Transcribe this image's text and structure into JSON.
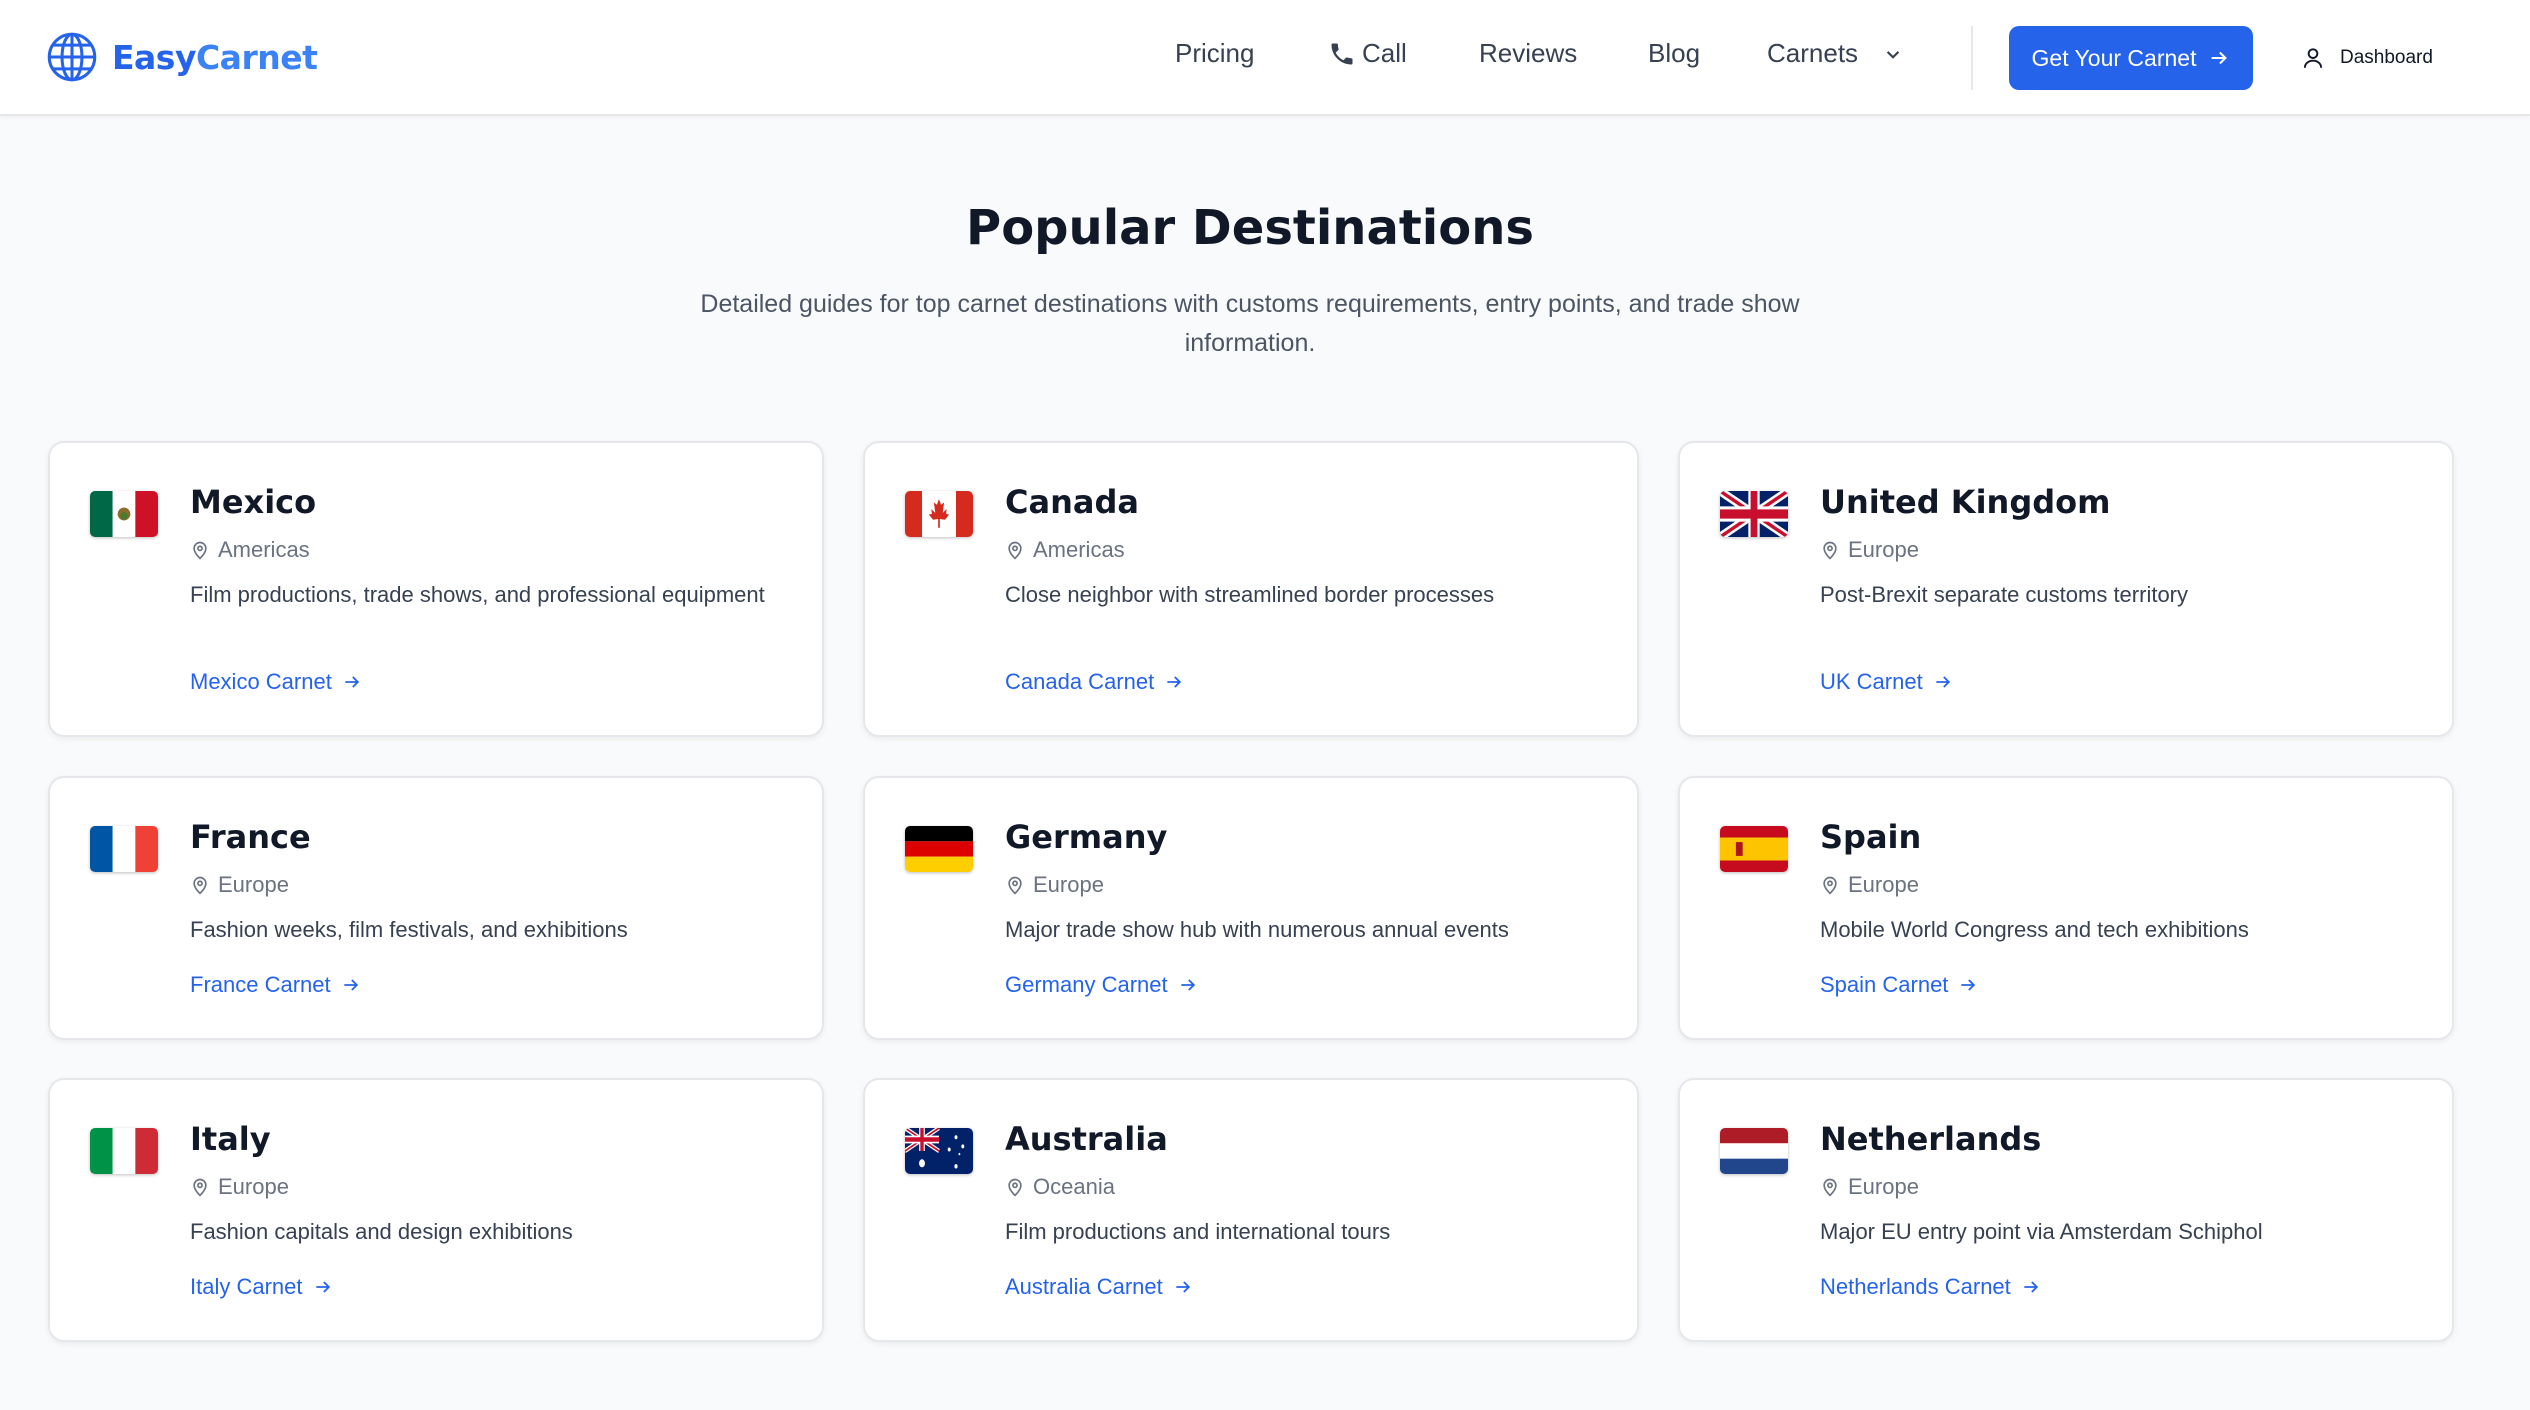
{
  "header": {
    "logo_easy": "Easy",
    "logo_carnet": "Carnet",
    "nav": {
      "pricing": "Pricing",
      "call": "Call",
      "reviews": "Reviews",
      "blog": "Blog",
      "carnets": "Carnets"
    },
    "cta_label": "Get Your Carnet",
    "dashboard_label": "Dashboard",
    "accent_color": "#2563eb"
  },
  "hero": {
    "title": "Popular Destinations",
    "subtitle": "Detailed guides for top carnet destinations with customs requirements, entry points, and trade show information."
  },
  "destinations": [
    {
      "name": "Mexico",
      "region": "Americas",
      "description": "Film productions, trade shows, and professional equipment",
      "link": "Mexico Carnet",
      "flag": "mexico-flag"
    },
    {
      "name": "Canada",
      "region": "Americas",
      "description": "Close neighbor with streamlined border processes",
      "link": "Canada Carnet",
      "flag": "canada-flag"
    },
    {
      "name": "United Kingdom",
      "region": "Europe",
      "description": "Post-Brexit separate customs territory",
      "link": "UK Carnet",
      "flag": "uk-flag"
    },
    {
      "name": "France",
      "region": "Europe",
      "description": "Fashion weeks, film festivals, and exhibitions",
      "link": "France Carnet",
      "flag": "france-flag"
    },
    {
      "name": "Germany",
      "region": "Europe",
      "description": "Major trade show hub with numerous annual events",
      "link": "Germany Carnet",
      "flag": "germany-flag"
    },
    {
      "name": "Spain",
      "region": "Europe",
      "description": "Mobile World Congress and tech exhibitions",
      "link": "Spain Carnet",
      "flag": "spain-flag"
    },
    {
      "name": "Italy",
      "region": "Europe",
      "description": "Fashion capitals and design exhibitions",
      "link": "Italy Carnet",
      "flag": "italy-flag"
    },
    {
      "name": "Australia",
      "region": "Oceania",
      "description": "Film productions and international tours",
      "link": "Australia Carnet",
      "flag": "australia-flag"
    },
    {
      "name": "Netherlands",
      "region": "Europe",
      "description": "Major EU entry point via Amsterdam Schiphol",
      "link": "Netherlands Carnet",
      "flag": "netherlands-flag"
    }
  ]
}
